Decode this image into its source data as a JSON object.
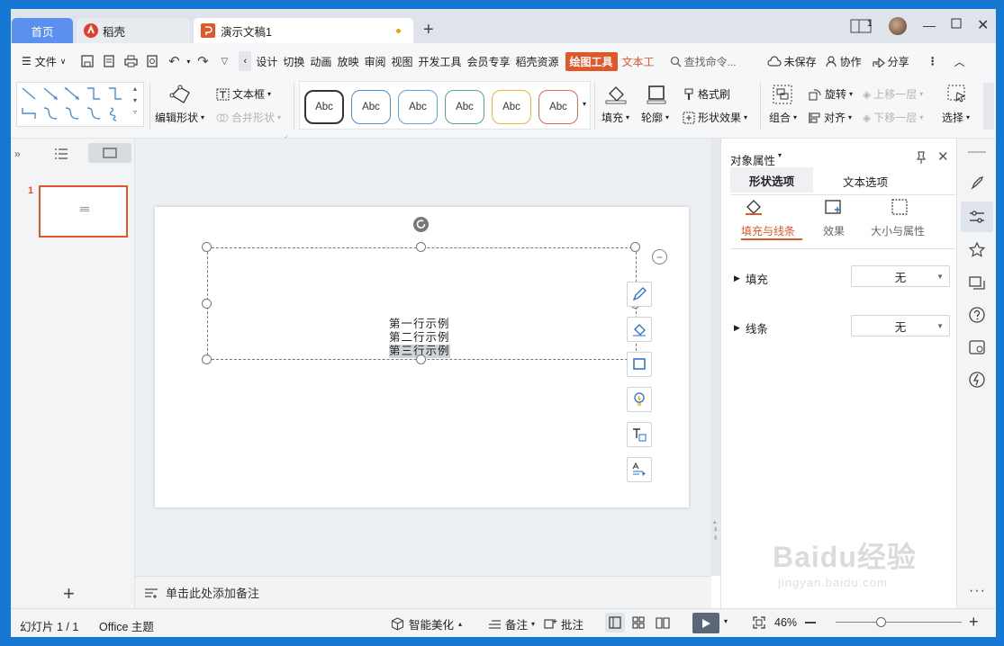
{
  "tabs": {
    "home": "首页",
    "daoke": "稻壳",
    "document": "演示文稿1",
    "new_tab": "+"
  },
  "window": {
    "badge": "1"
  },
  "menu": {
    "file": "文件",
    "items": [
      "设计",
      "切换",
      "动画",
      "放映",
      "审阅",
      "视图",
      "开发工具",
      "会员专享",
      "稻壳资源"
    ],
    "drawing_tools": "绘图工具",
    "text_tools": "文本工",
    "search_placeholder": "查找命令...",
    "unsaved": "未保存",
    "collaborate": "协作",
    "share": "分享"
  },
  "ribbon": {
    "edit_shape": "编辑形状",
    "text_box": "文本框",
    "merge_shape": "合并形状",
    "style_label": "Abc",
    "style_colors": [
      "#333333",
      "#4a90d9",
      "#56a8e0",
      "#4caf82",
      "#f0b43c",
      "#e06b50"
    ],
    "fill": "填充",
    "outline": "轮廓",
    "format_painter": "格式刷",
    "shape_effects": "形状效果",
    "group": "组合",
    "rotate": "旋转",
    "align": "对齐",
    "bring_forward": "上移一层",
    "send_backward": "下移一层",
    "select": "选择"
  },
  "slides_panel": {
    "slide_number": "1"
  },
  "slide": {
    "lines": [
      "第一行示例",
      "第二行示例",
      "第三行示例"
    ]
  },
  "notes": {
    "placeholder": "单击此处添加备注"
  },
  "properties": {
    "title": "对象属性",
    "tab_shape": "形状选项",
    "tab_text": "文本选项",
    "sub_fill_line": "填充与线条",
    "sub_effect": "效果",
    "sub_size": "大小与属性",
    "fill_label": "填充",
    "fill_value": "无",
    "line_label": "线条",
    "line_value": "无"
  },
  "status": {
    "slide_info": "幻灯片 1 / 1",
    "theme": "Office 主题",
    "smart_beautify": "智能美化",
    "notes": "备注",
    "comments": "批注",
    "zoom": "46%",
    "zoom_level": 0.46
  },
  "watermark": {
    "text": "Baidu经验",
    "url": "jingyan.baidu.com"
  },
  "colors": {
    "accent": "#e0572a",
    "tab_home": "#5b8ff0",
    "desktop": "#1778d4"
  }
}
